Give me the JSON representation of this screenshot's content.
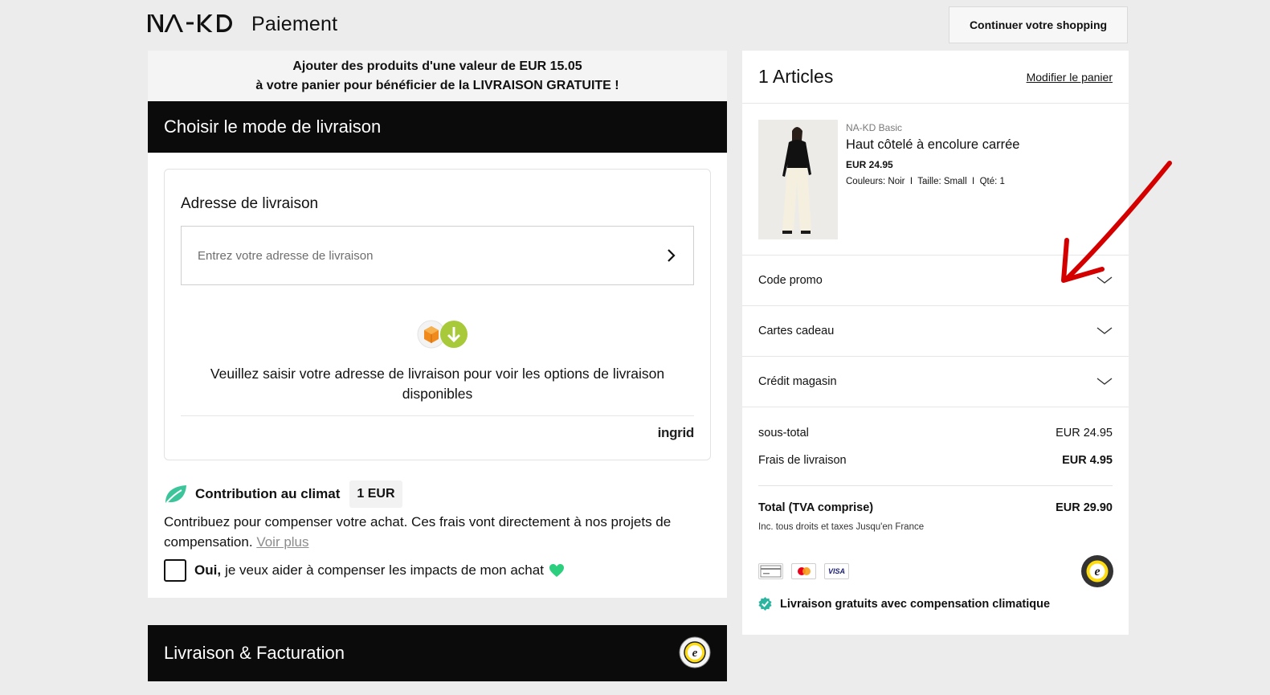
{
  "header": {
    "brand": "NA-KD",
    "page_title": "Paiement",
    "continue_label": "Continuer votre shopping"
  },
  "banner": {
    "line1": "Ajouter des produits d'une valeur de EUR 15.05",
    "line2": "à votre panier pour bénéficier de la LIVRAISON GRATUITE !"
  },
  "delivery": {
    "section_title": "Choisir le mode de livraison",
    "address_title": "Adresse de livraison",
    "address_placeholder": "Entrez votre adresse de livraison",
    "message": "Veuillez saisir votre adresse de livraison pour voir les options de livraison disponibles",
    "provider": "ingrid"
  },
  "climate": {
    "title": "Contribution au climat",
    "price": "1 EUR",
    "description": "Contribuez pour compenser votre achat. Ces frais vont directement à nos projets de compensation.",
    "more_link": "Voir plus",
    "opt_in_strong": "Oui,",
    "opt_in_text": "je veux aider à compenser les impacts de mon achat",
    "checked": false
  },
  "billing": {
    "section_title": "Livraison & Facturation"
  },
  "cart": {
    "count_label": "1 Articles",
    "modify_label": "Modifier le panier",
    "items": [
      {
        "brand": "NA-KD Basic",
        "name": "Haut côtelé à encolure carrée",
        "price": "EUR 24.95",
        "meta": "Couleurs: Noir  I  Taille: Small  I  Qté: 1"
      }
    ],
    "accordions": [
      {
        "label": "Code promo"
      },
      {
        "label": "Cartes cadeau"
      },
      {
        "label": "Crédit magasin"
      }
    ],
    "subtotal_label": "sous-total",
    "subtotal_value": "EUR 24.95",
    "shipping_label": "Frais de livraison",
    "shipping_value": "EUR 4.95",
    "total_label": "Total (TVA comprise)",
    "total_value": "EUR 29.90",
    "total_note": "Inc. tous droits et taxes Jusqu'en France",
    "payment_icons": [
      "card-icon",
      "mastercard-icon",
      "visa-icon"
    ],
    "visa_text": "VISA",
    "free_shipping_note": "Livraison gratuits avec compensation climatique"
  },
  "colors": {
    "section_head_bg": "#0b0b0b",
    "climate_green": "#3cc59a",
    "annotation_arrow": "#d40000"
  }
}
